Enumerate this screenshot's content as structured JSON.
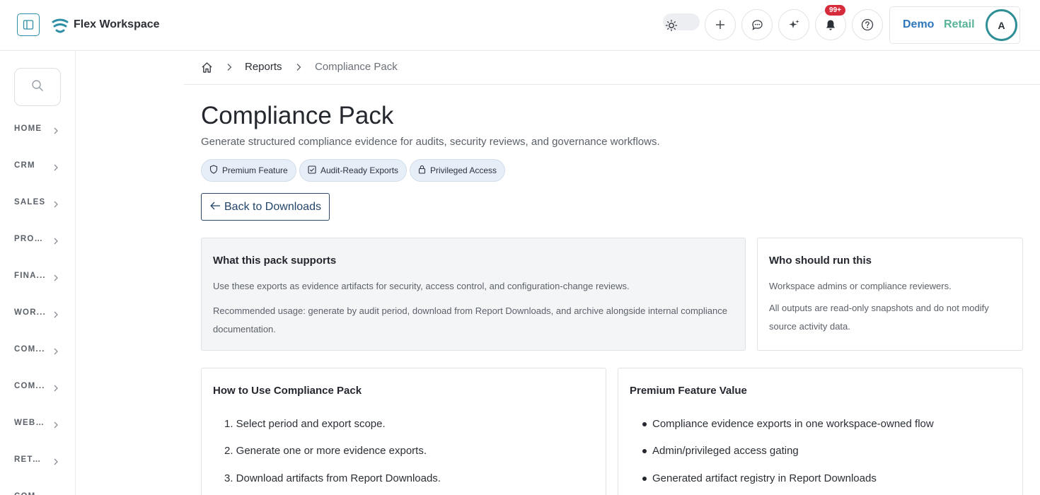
{
  "app": {
    "title": "Flex Workspace",
    "notification_count": "99+",
    "store_primary": "Demo",
    "store_secondary": "Retail",
    "avatar_initial": "A"
  },
  "colors": {
    "accent": "#2f8fa6",
    "badge": "#d62b3b",
    "pill_bg": "#e6eef8",
    "demo_text": "#2d76b9",
    "retail_text": "#58b39a"
  },
  "icons": {
    "topbar": [
      "sidebar-toggle-icon",
      "logo-icon",
      "sun-icon",
      "plus-icon",
      "chat-icon",
      "sparkle-icon",
      "bell-icon",
      "help-icon"
    ],
    "pills": [
      "shield-icon",
      "check-square-icon",
      "lock-icon"
    ]
  },
  "sidebar": {
    "items": [
      {
        "label": "HOME"
      },
      {
        "label": "CRM"
      },
      {
        "label": "SALES"
      },
      {
        "label": "PROJ..."
      },
      {
        "label": "FINA..."
      },
      {
        "label": "WOR..."
      },
      {
        "label": "COM..."
      },
      {
        "label": "COM..."
      },
      {
        "label": "WEB ..."
      },
      {
        "label": "RETAIL"
      },
      {
        "label": "COM..."
      }
    ]
  },
  "breadcrumb": {
    "items": [
      "Reports",
      "Compliance Pack"
    ]
  },
  "page": {
    "title": "Compliance Pack",
    "subtitle": "Generate structured compliance evidence for audits, security reviews, and governance workflows.",
    "pills": [
      "Premium Feature",
      "Audit-Ready Exports",
      "Privileged Access"
    ],
    "back_label": "Back to Downloads"
  },
  "cards": {
    "supports": {
      "title": "What this pack supports",
      "lines": [
        "Use these exports as evidence artifacts for security, access control, and configuration-change reviews.",
        "Recommended usage: generate by audit period, download from Report Downloads, and archive alongside internal compliance documentation."
      ]
    },
    "who": {
      "title": "Who should run this",
      "lines": [
        "Workspace admins or compliance reviewers.",
        "All outputs are read-only snapshots and do not modify source activity data."
      ]
    },
    "howto": {
      "title": "How to Use Compliance Pack",
      "steps": [
        "1. Select period and export scope.",
        "2. Generate one or more evidence exports.",
        "3. Download artifacts from Report Downloads."
      ]
    },
    "value": {
      "title": "Premium Feature Value",
      "bullets": [
        "Compliance evidence exports in one workspace-owned flow",
        "Admin/privileged access gating",
        "Generated artifact registry in Report Downloads"
      ]
    }
  }
}
